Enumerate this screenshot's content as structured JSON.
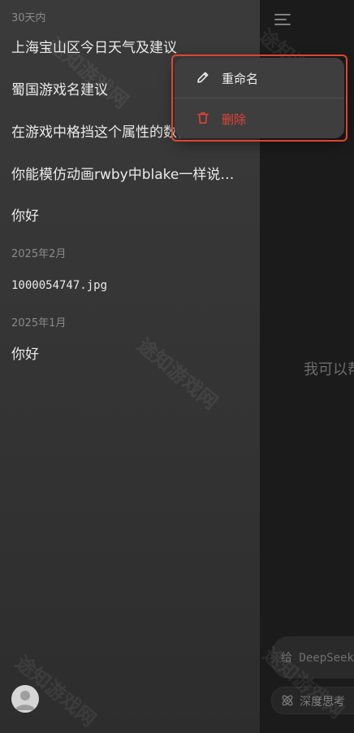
{
  "sidebar": {
    "sections": [
      {
        "label": "30天内",
        "items": [
          {
            "title": "上海宝山区今日天气及建议"
          },
          {
            "title": "蜀国游戏名建议"
          },
          {
            "title": "在游戏中格挡这个属性的数值……"
          },
          {
            "title": "你能模仿动画rwby中blake一样说…"
          },
          {
            "title": "你好"
          }
        ]
      },
      {
        "label": "2025年2月",
        "items": [
          {
            "title": "1000054747.jpg"
          }
        ]
      },
      {
        "label": "2025年1月",
        "items": [
          {
            "title": "你好"
          }
        ]
      }
    ]
  },
  "popup": {
    "rename_label": "重命名",
    "delete_label": "删除"
  },
  "main": {
    "welcome": "我可以帮",
    "input_placeholder": "给 DeepSeek",
    "deep_think_label": "深度思考"
  },
  "watermark": "途知游戏网",
  "colors": {
    "sidebar_bg": "#353535",
    "main_bg": "#1b1b1b",
    "popup_bg": "#3e3e3e",
    "delete_red": "#e5413a",
    "highlight_border": "#e0452b"
  }
}
